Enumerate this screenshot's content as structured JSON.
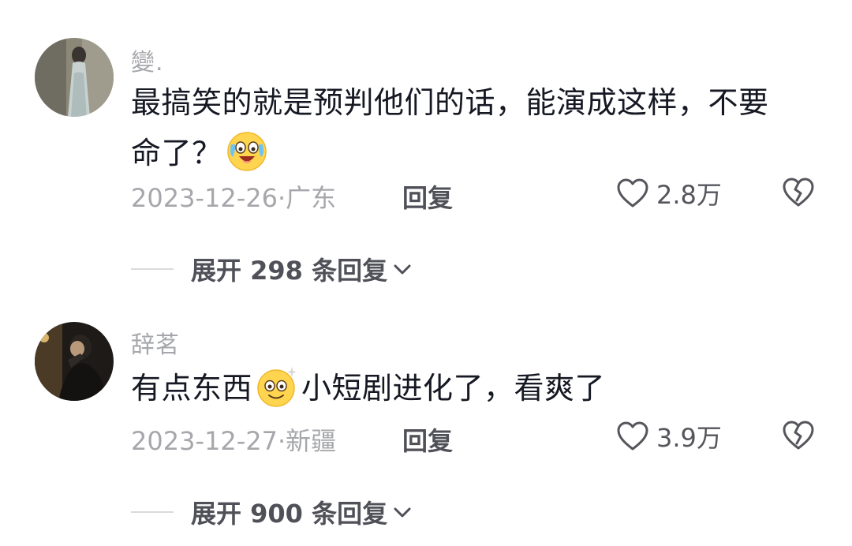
{
  "comments": [
    {
      "username": "變.",
      "text_before": "最搞笑的就是预判他们的话，能演成这样，不要命了？",
      "emoji": "crying-laughing-emoji",
      "text_after": "",
      "date": "2023-12-26",
      "location_separator": "·",
      "location": "广东",
      "reply_label": "回复",
      "likes": "2.8万",
      "expand_label": "展开 298 条回复"
    },
    {
      "username": "辞茗",
      "text_before": "有点东西",
      "emoji": "sparkle-smile-emoji",
      "text_after": "小短剧进化了，看爽了",
      "date": "2023-12-27",
      "location_separator": "·",
      "location": "新疆",
      "reply_label": "回复",
      "likes": "3.9万",
      "expand_label": "展开 900 条回复"
    }
  ],
  "icons": {
    "like": "heart-outline-icon",
    "dislike": "broken-heart-icon",
    "expand": "chevron-down-icon"
  },
  "colors": {
    "text_primary": "#161823",
    "text_secondary": "#a6a7ab",
    "action": "#4f5058",
    "emoji_yellow": "#ffd54f"
  }
}
